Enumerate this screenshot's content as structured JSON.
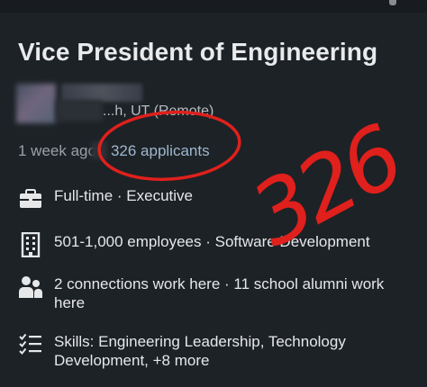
{
  "job": {
    "title": "Vice President of Engineering",
    "location": "...h, UT (Remote)",
    "posted": "1 week ago",
    "applicants": "326 applicants"
  },
  "details": [
    {
      "icon": "briefcase-icon",
      "text": "Full-time · Executive"
    },
    {
      "icon": "company-building-icon",
      "text": "501-1,000 employees · Software Development"
    },
    {
      "icon": "people-icon",
      "text": "2 connections work here · 11 school alumni work here"
    },
    {
      "icon": "checklist-icon",
      "text": "Skills: Engineering Leadership, Technology Development, +8 more"
    }
  ],
  "annotation": {
    "handwritten_number": "326",
    "color": "#e0201c"
  },
  "colors": {
    "background": "#1d2226",
    "title_text": "#e9eaec",
    "meta_text": "#9aa0a7",
    "applicants_text": "#9fb7ce",
    "annotation_red": "#e0201c"
  }
}
